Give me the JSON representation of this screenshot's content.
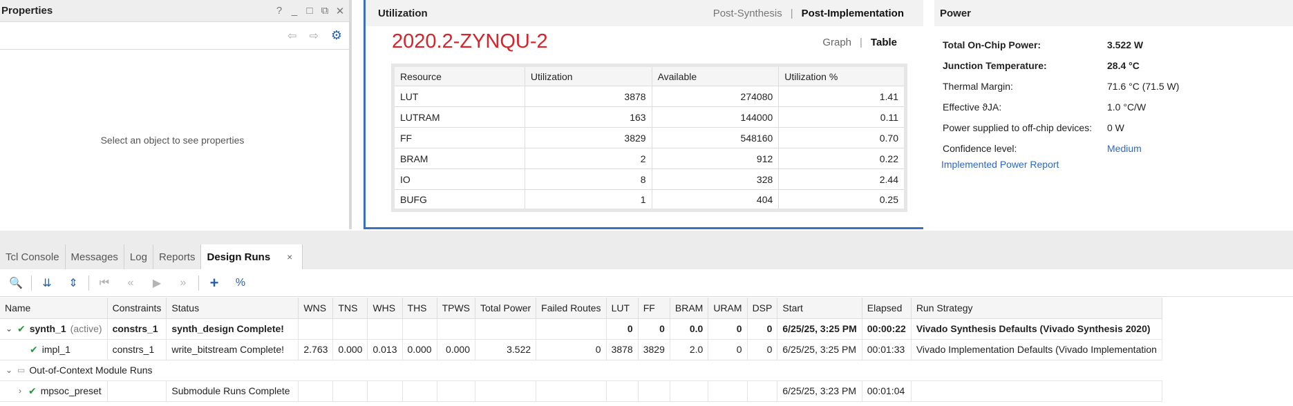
{
  "properties": {
    "title": "Properties",
    "controls": [
      "?",
      "_",
      "□",
      "⧉",
      "✕"
    ],
    "nav": {
      "back": "⇦",
      "forward": "⇨",
      "settings": "⚙"
    },
    "empty_message": "Select an object to see properties"
  },
  "utilization": {
    "title": "Utilization",
    "tabs": {
      "post_synthesis": "Post-Synthesis",
      "separator": "|",
      "post_implementation": "Post-Implementation"
    },
    "device": "2020.2-ZYNQU-2",
    "view_tabs": {
      "graph": "Graph",
      "separator": "|",
      "table": "Table"
    },
    "columns": [
      "Resource",
      "Utilization",
      "Available",
      "Utilization %"
    ],
    "rows": [
      {
        "resource": "LUT",
        "utilization": "3878",
        "available": "274080",
        "percent": "1.41"
      },
      {
        "resource": "LUTRAM",
        "utilization": "163",
        "available": "144000",
        "percent": "0.11"
      },
      {
        "resource": "FF",
        "utilization": "3829",
        "available": "548160",
        "percent": "0.70"
      },
      {
        "resource": "BRAM",
        "utilization": "2",
        "available": "912",
        "percent": "0.22"
      },
      {
        "resource": "IO",
        "utilization": "8",
        "available": "328",
        "percent": "2.44"
      },
      {
        "resource": "BUFG",
        "utilization": "1",
        "available": "404",
        "percent": "0.25"
      }
    ]
  },
  "power": {
    "title": "Power",
    "rows": [
      {
        "label": "Total On-Chip Power:",
        "value": "3.522 W"
      },
      {
        "label": "Junction Temperature:",
        "value": "28.4 °C"
      },
      {
        "label": "Thermal Margin:",
        "value": "71.6 °C (71.5 W)"
      },
      {
        "label": "Effective ϑJA:",
        "value": "1.0 °C/W"
      },
      {
        "label": "Power supplied to off-chip devices:",
        "value": "0 W"
      },
      {
        "label": "Confidence level:",
        "value": "Medium"
      }
    ],
    "report_link": "Implemented Power Report"
  },
  "bottom": {
    "tabs": [
      "Tcl Console",
      "Messages",
      "Log",
      "Reports",
      "Design Runs"
    ],
    "close_icon": "×",
    "toolbar": {
      "search": "🔍",
      "collapse_all": "⇊",
      "expand_all": "⇕",
      "first": "⏮",
      "prev": "«",
      "play": "▶",
      "next": "»",
      "add": "+",
      "percent": "%"
    },
    "columns": [
      "Name",
      "Constraints",
      "Status",
      "WNS",
      "TNS",
      "WHS",
      "THS",
      "TPWS",
      "Total Power",
      "Failed Routes",
      "LUT",
      "FF",
      "BRAM",
      "URAM",
      "DSP",
      "Start",
      "Elapsed",
      "Run Strategy"
    ],
    "runs": [
      {
        "name": "synth_1",
        "suffix": "(active)",
        "constraints": "constrs_1",
        "status": "synth_design Complete!",
        "wns": "",
        "tns": "",
        "whs": "",
        "ths": "",
        "tpws": "",
        "power": "",
        "failed": "",
        "lut": "0",
        "ff": "0",
        "bram": "0.0",
        "uram": "0",
        "dsp": "0",
        "start": "6/25/25, 3:25 PM",
        "elapsed": "00:00:22",
        "strategy": "Vivado Synthesis Defaults (Vivado Synthesis 2020)"
      },
      {
        "name": "impl_1",
        "suffix": "",
        "constraints": "constrs_1",
        "status": "write_bitstream Complete!",
        "wns": "2.763",
        "tns": "0.000",
        "whs": "0.013",
        "ths": "0.000",
        "tpws": "0.000",
        "power": "3.522",
        "failed": "0",
        "lut": "3878",
        "ff": "3829",
        "bram": "2.0",
        "uram": "0",
        "dsp": "0",
        "start": "6/25/25, 3:25 PM",
        "elapsed": "00:01:33",
        "strategy": "Vivado Implementation Defaults (Vivado Implementation"
      },
      {
        "group": "Out-of-Context Module Runs"
      },
      {
        "name": "mpsoc_preset",
        "suffix": "",
        "constraints": "",
        "status": "Submodule Runs Complete",
        "wns": "",
        "tns": "",
        "whs": "",
        "ths": "",
        "tpws": "",
        "power": "",
        "failed": "",
        "lut": "",
        "ff": "",
        "bram": "",
        "uram": "",
        "dsp": "",
        "start": "6/25/25, 3:23 PM",
        "elapsed": "00:01:04",
        "strategy": ""
      }
    ]
  }
}
